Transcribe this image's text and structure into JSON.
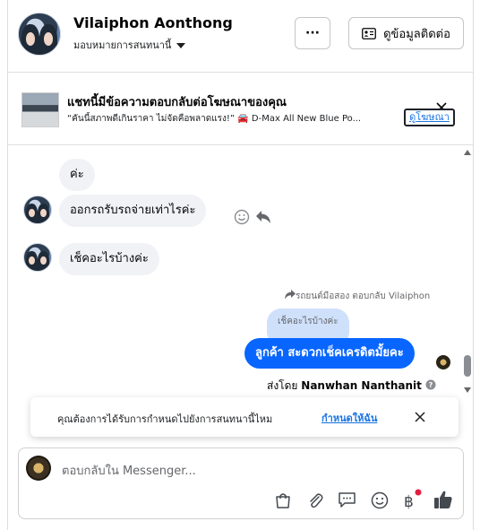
{
  "header": {
    "name": "Vilaiphon Aonthong",
    "assign_label": "มอบหมายการสนทนานี้",
    "more_label": "···",
    "contact_label": "ดูข้อมูลติดต่อ"
  },
  "ad": {
    "title": "แชทนี้มีข้อความตอบกลับต่อโฆษณาของคุณ",
    "description": "“คันนี้สภาพดีเกินราคา ไม่จัดคือพลาดแรง!” 🚘 D-Max All New Blue Po...",
    "link_label": "ดูโฆษณา"
  },
  "messages": [
    {
      "text": "ค่ะ"
    },
    {
      "text": "ออกรถรับรถจ่ายเท่าไรค่ะ"
    },
    {
      "text": "เช็คอะไรบ้างค่ะ"
    }
  ],
  "reply": {
    "context": "รถยนต์มือสอง ตอบกลับ Vilaiphon",
    "quoted": "เช็คอะไรบ้างค่ะ",
    "text": "ลูกค้า สะดวกเช็คเครดิตมั้ยคะ",
    "sent_by_prefix": "ส่งโดย",
    "sent_by_name": "Nanwhan Nanthanit"
  },
  "notification": {
    "text": "คุณต้องการได้รับการกำหนดไปยังการสนทนานี้ไหม",
    "action": "กำหนดให้ฉัน"
  },
  "composer": {
    "placeholder": "ตอบกลับใน Messenger..."
  },
  "colors": {
    "accent": "#0866ff",
    "incoming_bubble": "#f0f2f5",
    "quoted_bubble": "#cfe0fb",
    "notification_dot": "#e41e3f"
  }
}
